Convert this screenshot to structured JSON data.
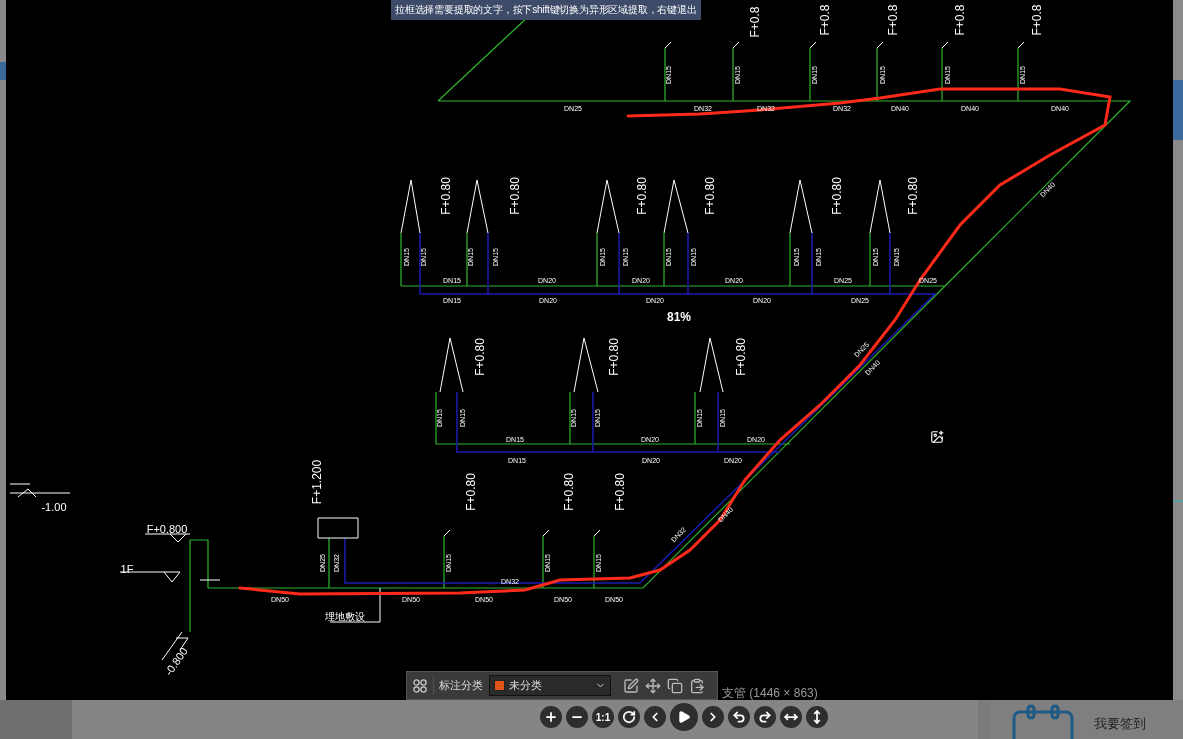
{
  "tooltip": "拉框选择需要提取的文字，按下shift键切换为异形区域提取，右键退出",
  "zoom_level": "81%",
  "drawing": {
    "horizontal_pipe_labels": [
      "DN25",
      "DN32",
      "DN32",
      "DN32",
      "DN40",
      "DN40",
      "DN40",
      "DN15",
      "DN20",
      "DN20",
      "DN20",
      "DN25",
      "DN25",
      "DN15",
      "DN20",
      "DN20",
      "DN20",
      "DN25",
      "DN15",
      "DN20",
      "DN20",
      "DN15",
      "DN20",
      "DN20",
      "DN50",
      "DN50",
      "DN50",
      "DN50",
      "DN50",
      "DN32"
    ],
    "riser_labels": [
      "DN15",
      "DN15",
      "DN15",
      "DN15",
      "DN15",
      "DN15",
      "DN15",
      "DN15",
      "DN15",
      "DN15",
      "DN15",
      "DN15",
      "DN15",
      "DN15",
      "DN15",
      "DN15",
      "DN15",
      "DN15",
      "DN15",
      "DN15",
      "DN15",
      "DN15",
      "DN15",
      "DN15",
      "DN25",
      "DN32",
      "DN15",
      "DN15",
      "DN15"
    ],
    "elevation_labels": [
      "F+0.8",
      "F+0.8",
      "F+0.8",
      "F+0.8",
      "F+0.8",
      "F+0.80",
      "F+0.80",
      "F+0.80",
      "F+0.80",
      "F+0.80",
      "F+0.80",
      "F+0.80",
      "F+0.80",
      "F+0.80",
      "F+1.200",
      "F+0.80",
      "F+0.80",
      "F+0.80"
    ],
    "diagonal_pipe_labels": [
      "DN40",
      "DN25",
      "DN40",
      "DN32",
      "DN40"
    ],
    "level_labels": [
      "F+0.800",
      "1F",
      "-1.00",
      "-0.800"
    ],
    "note": "埋地敷设"
  },
  "annotation_toolbar": {
    "label": "标注分类",
    "category": "未分类"
  },
  "image_caption": "支管 (1446 × 863)",
  "viewer_controls": [
    {
      "kind": "zoom_in"
    },
    {
      "kind": "zoom_out"
    },
    {
      "kind": "actual_size",
      "label": "1:1"
    },
    {
      "kind": "refresh"
    },
    {
      "kind": "previous"
    },
    {
      "kind": "play"
    },
    {
      "kind": "next"
    },
    {
      "kind": "rotate_left"
    },
    {
      "kind": "rotate_right"
    },
    {
      "kind": "flip_horizontal"
    },
    {
      "kind": "flip_vertical"
    }
  ],
  "checkin": {
    "label": "我要签到"
  }
}
